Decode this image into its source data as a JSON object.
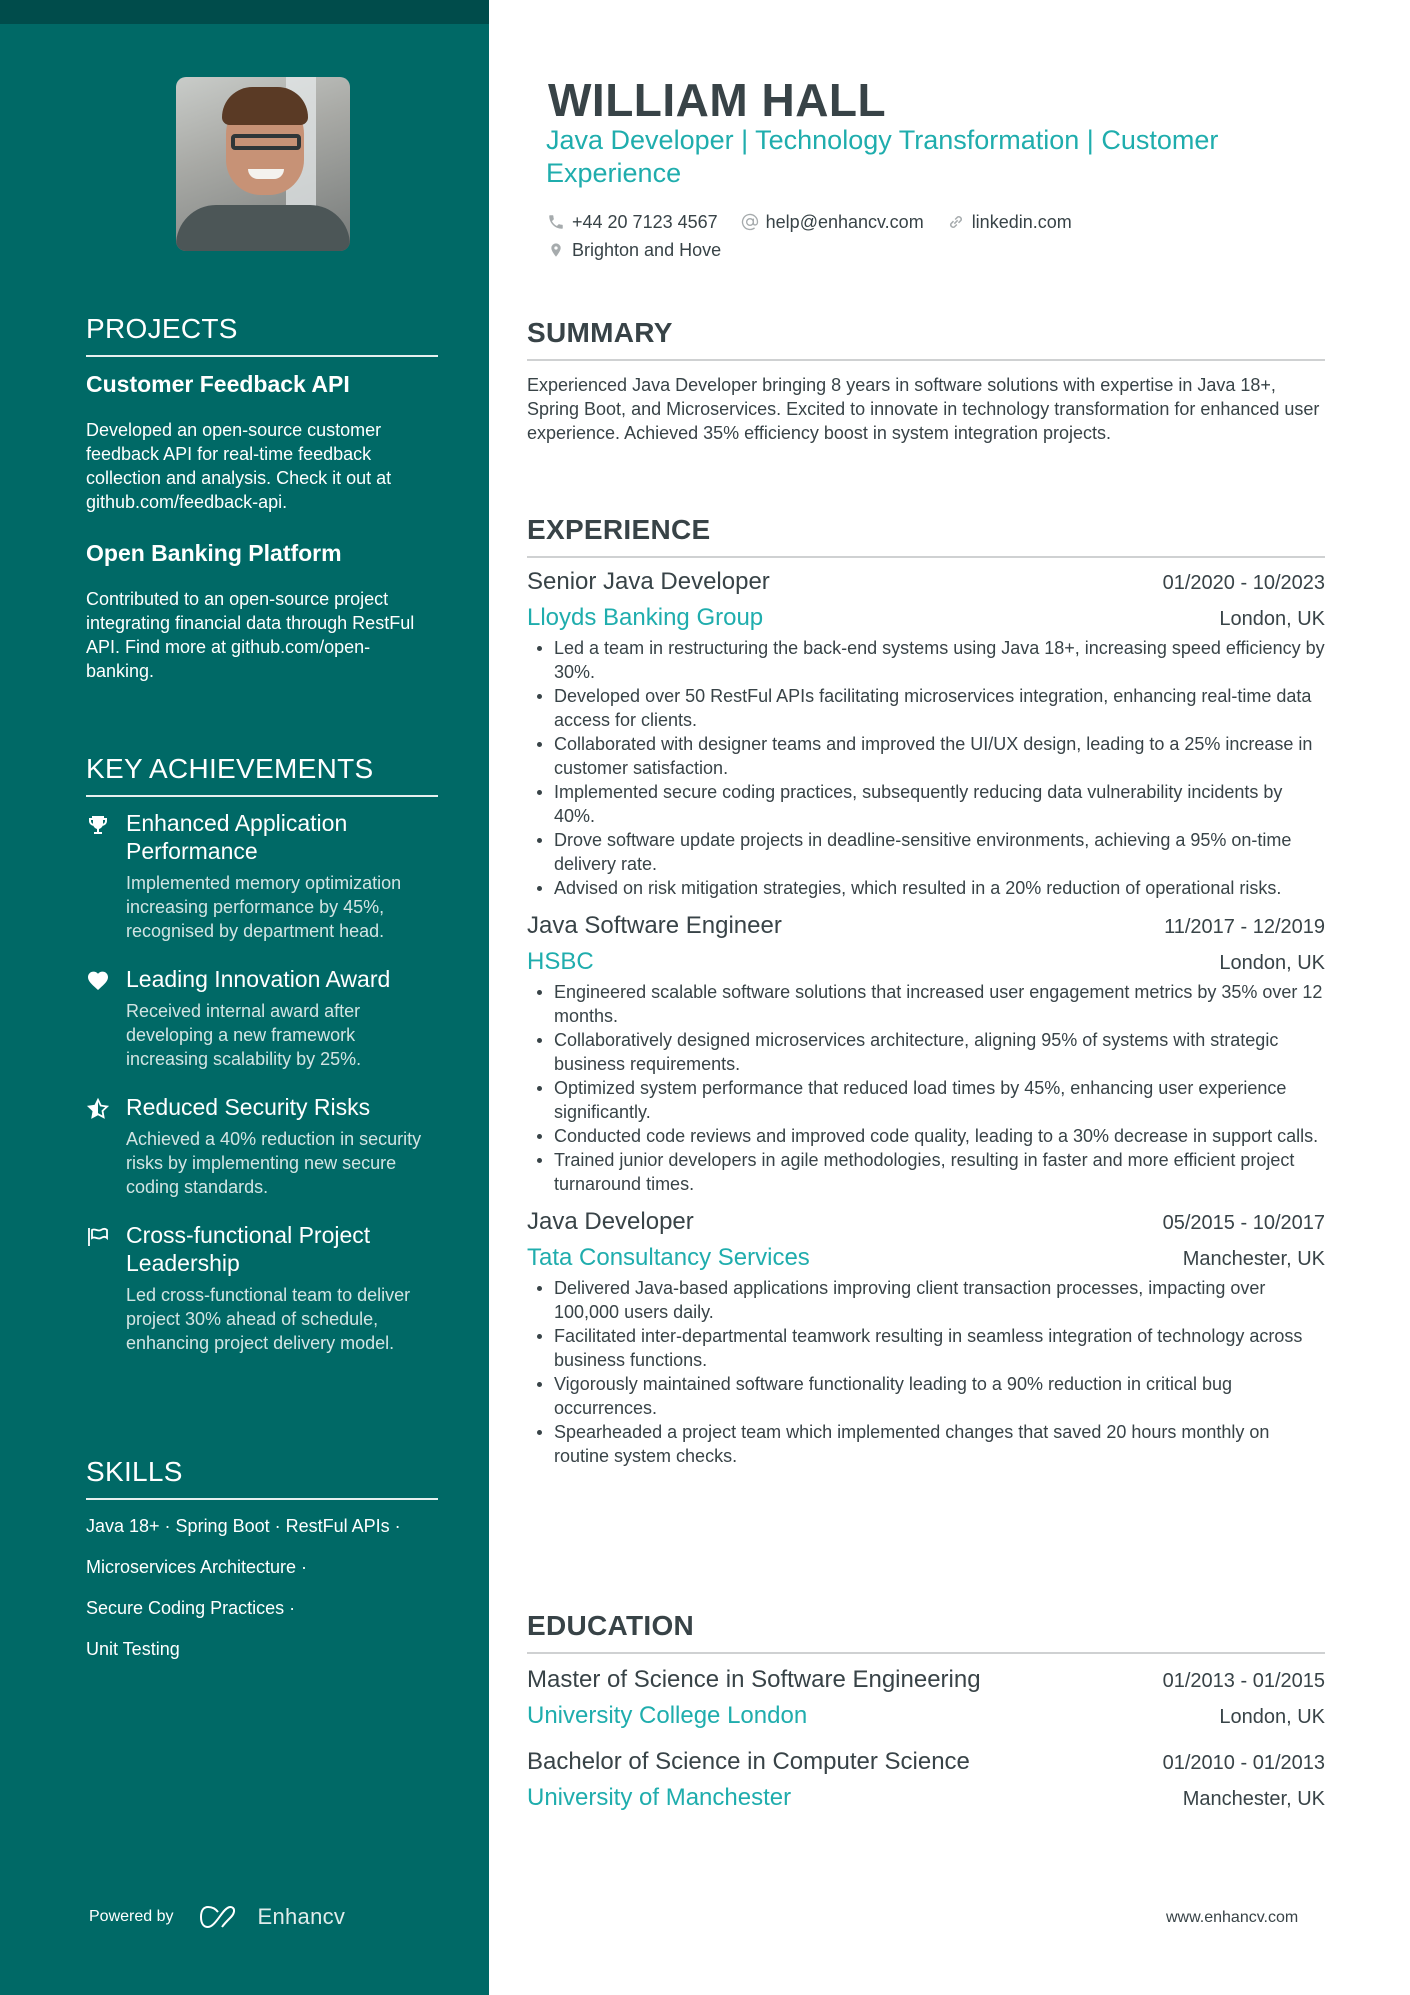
{
  "header": {
    "name": "WILLIAM HALL",
    "role": "Java Developer | Technology Transformation | Customer Experience",
    "contacts": [
      {
        "icon": "phone-icon",
        "text": "+44 20 7123 4567"
      },
      {
        "icon": "at-icon",
        "text": "help@enhancv.com"
      },
      {
        "icon": "link-icon",
        "text": "linkedin.com"
      },
      {
        "icon": "location-pin-icon",
        "text": "Brighton and Hove"
      }
    ]
  },
  "sidebar": {
    "projects": {
      "heading": "PROJECTS",
      "items": [
        {
          "title": "Customer Feedback API",
          "description": "Developed an open-source customer feedback API for real-time feedback collection and analysis. Check it out at github.com/feedback-api."
        },
        {
          "title": "Open Banking Platform",
          "description": "Contributed to an open-source project integrating financial data through RestFul API. Find more at github.com/open-banking."
        }
      ]
    },
    "achievements": {
      "heading": "KEY ACHIEVEMENTS",
      "items": [
        {
          "icon": "trophy-icon",
          "title": "Enhanced Application Performance",
          "description": "Implemented memory optimization increasing performance by 45%, recognised by department head."
        },
        {
          "icon": "heart-icon",
          "title": "Leading Innovation Award",
          "description": "Received internal award after developing a new framework increasing scalability by 25%."
        },
        {
          "icon": "half-star-icon",
          "title": "Reduced Security Risks",
          "description": "Achieved a 40% reduction in security risks by implementing new secure coding standards."
        },
        {
          "icon": "flag-icon",
          "title": "Cross-functional Project Leadership",
          "description": "Led cross-functional team to deliver project 30% ahead of schedule, enhancing project delivery model."
        }
      ]
    },
    "skills": {
      "heading": "SKILLS",
      "lines": [
        "Java 18+ · Spring Boot · RestFul APIs ·",
        "Microservices Architecture ·",
        "Secure Coding Practices ·",
        "Unit Testing"
      ]
    },
    "powered_by": "Powered by",
    "brand": "Enhancv"
  },
  "summary": {
    "heading": "SUMMARY",
    "text": "Experienced Java Developer bringing 8 years in software solutions with expertise in Java 18+, Spring Boot, and Microservices. Excited to innovate in technology transformation for enhanced user experience. Achieved 35% efficiency boost in system integration projects."
  },
  "experience": {
    "heading": "EXPERIENCE",
    "jobs": [
      {
        "title": "Senior Java Developer",
        "dates": "01/2020 - 10/2023",
        "company": "Lloyds Banking Group",
        "location": "London, UK",
        "bullets": [
          "Led a team in restructuring the back-end systems using Java 18+, increasing speed efficiency by 30%.",
          "Developed over 50 RestFul APIs facilitating microservices integration, enhancing real-time data access for clients.",
          "Collaborated with designer teams and improved the UI/UX design, leading to a 25% increase in customer satisfaction.",
          "Implemented secure coding practices, subsequently reducing data vulnerability incidents by 40%.",
          "Drove software update projects in deadline-sensitive environments, achieving a 95% on-time delivery rate.",
          "Advised on risk mitigation strategies, which resulted in a 20% reduction of operational risks."
        ]
      },
      {
        "title": "Java Software Engineer",
        "dates": "11/2017 - 12/2019",
        "company": "HSBC",
        "location": "London, UK",
        "bullets": [
          "Engineered scalable software solutions that increased user engagement metrics by 35% over 12 months.",
          "Collaboratively designed microservices architecture, aligning 95% of systems with strategic business requirements.",
          "Optimized system performance that reduced load times by 45%, enhancing user experience significantly.",
          "Conducted code reviews and improved code quality, leading to a 30% decrease in support calls.",
          "Trained junior developers in agile methodologies, resulting in faster and more efficient project turnaround times."
        ]
      },
      {
        "title": "Java Developer",
        "dates": "05/2015 - 10/2017",
        "company": "Tata Consultancy Services",
        "location": "Manchester, UK",
        "bullets": [
          "Delivered Java-based applications improving client transaction processes, impacting over 100,000 users daily.",
          "Facilitated inter-departmental teamwork resulting in seamless integration of technology across business functions.",
          "Vigorously maintained software functionality leading to a 90% reduction in critical bug occurrences.",
          "Spearheaded a project team which implemented changes that saved 20 hours monthly on routine system checks."
        ]
      }
    ]
  },
  "education": {
    "heading": "EDUCATION",
    "items": [
      {
        "degree": "Master of Science in Software Engineering",
        "dates": "01/2013 - 01/2015",
        "school": "University College London",
        "location": "London, UK"
      },
      {
        "degree": "Bachelor of Science in Computer Science",
        "dates": "01/2010 - 01/2013",
        "school": "University of Manchester",
        "location": "Manchester, UK"
      }
    ]
  },
  "footer": {
    "url": "www.enhancv.com"
  },
  "colors": {
    "sidebar": "#006966",
    "sidebar_top": "#004c4b",
    "accent": "#1fadad",
    "text": "#384347"
  }
}
